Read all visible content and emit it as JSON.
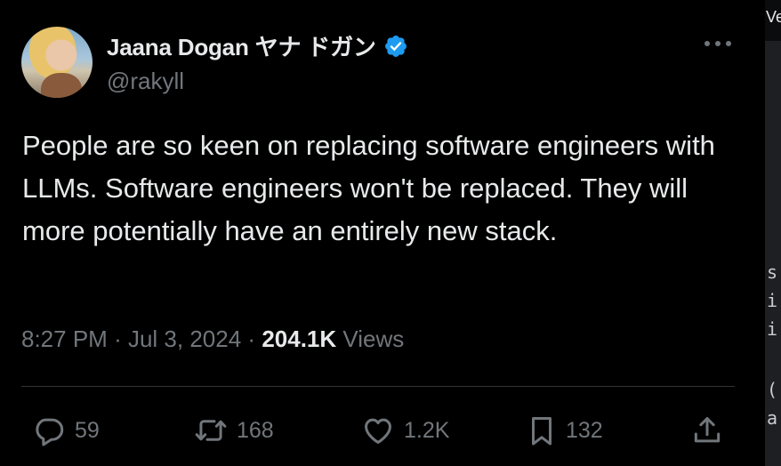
{
  "tweet": {
    "author": {
      "name": "Jaana Dogan ヤナ ドガン",
      "handle": "@rakyll",
      "verified": true
    },
    "text": "People are so keen on replacing software engineers with LLMs. Software engineers won't be replaced. They will more potentially have an entirely new stack.",
    "time": "8:27 PM",
    "separator": "·",
    "date": "Jul 3, 2024",
    "views_count": "204.1K",
    "views_label": "Views",
    "actions": {
      "replies": "59",
      "reposts": "168",
      "likes": "1.2K",
      "bookmarks": "132"
    }
  },
  "background_window": {
    "tab_fragment": "Ve",
    "code_fragments": [
      "s",
      "i",
      "i",
      "(",
      "a"
    ]
  },
  "colors": {
    "background": "#000000",
    "text": "#e7e9ea",
    "secondary": "#71767b",
    "verified": "#1d9bf0",
    "divider": "#2f3336"
  },
  "icons": [
    "verified-badge-icon",
    "more-icon",
    "reply-icon",
    "repost-icon",
    "like-icon",
    "bookmark-icon",
    "share-icon"
  ]
}
